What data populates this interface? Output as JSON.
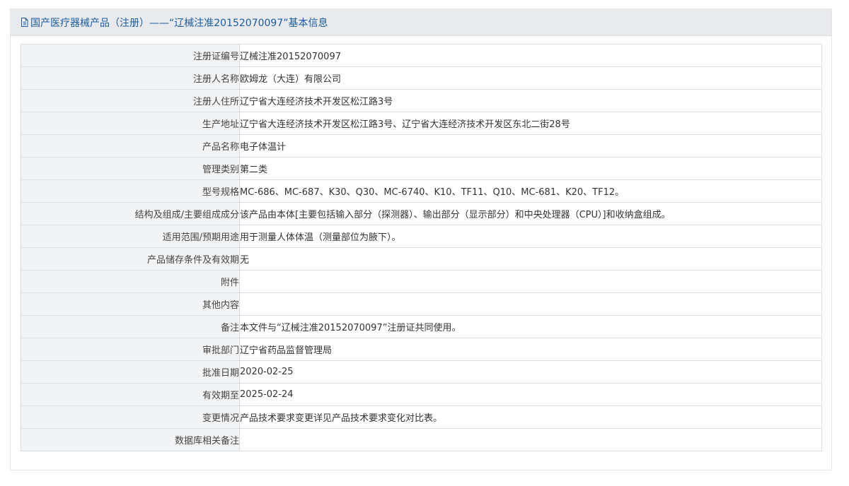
{
  "header": {
    "icon": "document-icon",
    "title": "国产医疗器械产品（注册）——“辽械注准20152070097”基本信息"
  },
  "colors": {
    "title": "#1a5c9e",
    "header_bg": "#e9eaed",
    "label_bg": "#f2f3f5",
    "border": "#d9dde3"
  },
  "rows": [
    {
      "label": "注册证编号",
      "value": "辽械注准20152070097"
    },
    {
      "label": "注册人名称",
      "value": "欧姆龙（大连）有限公司"
    },
    {
      "label": "注册人住所",
      "value": "辽宁省大连经济技术开发区松江路3号"
    },
    {
      "label": "生产地址",
      "value": "辽宁省大连经济技术开发区松江路3号、辽宁省大连经济技术开发区东北二街28号"
    },
    {
      "label": "产品名称",
      "value": "电子体温计"
    },
    {
      "label": "管理类别",
      "value": "第二类"
    },
    {
      "label": "型号规格",
      "value": "MC-686、MC-687、K30、Q30、MC-6740、K10、TF11、Q10、MC-681、K20、TF12。"
    },
    {
      "label": "结构及组成/主要组成成分",
      "value": "该产品由本体[主要包括输入部分（探测器）、输出部分（显示部分）和中央处理器（CPU）]和收纳盒组成。"
    },
    {
      "label": "适用范围/预期用途",
      "value": "用于测量人体体温（测量部位为腋下）。"
    },
    {
      "label": "产品储存条件及有效期",
      "value": "无"
    },
    {
      "label": "附件",
      "value": ""
    },
    {
      "label": "其他内容",
      "value": ""
    },
    {
      "label": "备注",
      "value": "本文件与“辽械注准20152070097”注册证共同使用。"
    },
    {
      "label": "审批部门",
      "value": "辽宁省药品监督管理局"
    },
    {
      "label": "批准日期",
      "value": "2020-02-25"
    },
    {
      "label": "有效期至",
      "value": "2025-02-24"
    },
    {
      "label": "变更情况",
      "value": "产品技术要求变更详见产品技术要求变化对比表。"
    },
    {
      "label": "数据库相关备注",
      "value": ""
    }
  ]
}
